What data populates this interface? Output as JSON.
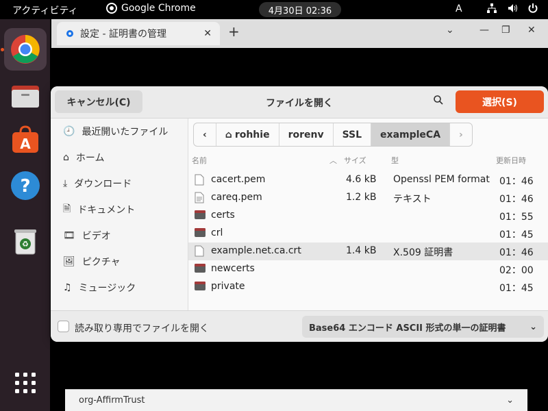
{
  "topbar": {
    "activities": "アクティビティ",
    "app_name": "Google Chrome",
    "clock": "4月30日  02:36",
    "input_method": "A"
  },
  "dock": {
    "apps": [
      {
        "name": "chrome-icon"
      },
      {
        "name": "files-icon"
      },
      {
        "name": "app-center-icon"
      },
      {
        "name": "help-icon"
      },
      {
        "name": "trash-icon"
      },
      {
        "name": "app-grid-icon"
      }
    ]
  },
  "browser": {
    "tab_title": "設定 - 証明書の管理",
    "new_tab": "+",
    "bottom_item": "org-AffirmTrust"
  },
  "dialog": {
    "title": "ファイルを開く",
    "cancel_label": "キャンセル(C)",
    "select_label": "選択(S)",
    "sidebar": [
      {
        "label": "最近開いたファイル",
        "icon": "recent-icon"
      },
      {
        "label": "ホーム",
        "icon": "home-icon"
      },
      {
        "label": "ダウンロード",
        "icon": "download-icon"
      },
      {
        "label": "ドキュメント",
        "icon": "document-icon"
      },
      {
        "label": "ビデオ",
        "icon": "video-icon"
      },
      {
        "label": "ピクチャ",
        "icon": "picture-icon"
      },
      {
        "label": "ミュージック",
        "icon": "music-icon"
      }
    ],
    "path": [
      "rohhie",
      "rorenv",
      "SSL",
      "exampleCA"
    ],
    "columns": {
      "name": "名前",
      "size": "サイズ",
      "type": "型",
      "modified": "更新日時"
    },
    "files": [
      {
        "name": "cacert.pem",
        "size": "4.6 kB",
        "type": "Openssl PEM format",
        "modified": "01：46",
        "kind": "file"
      },
      {
        "name": "careq.pem",
        "size": "1.2 kB",
        "type": "テキスト",
        "modified": "01：46",
        "kind": "text"
      },
      {
        "name": "certs",
        "size": "",
        "type": "",
        "modified": "01：55",
        "kind": "folder"
      },
      {
        "name": "crl",
        "size": "",
        "type": "",
        "modified": "01：45",
        "kind": "folder"
      },
      {
        "name": "example.net.ca.crt",
        "size": "1.4 kB",
        "type": "X.509 証明書",
        "modified": "01：46",
        "kind": "file"
      },
      {
        "name": "newcerts",
        "size": "",
        "type": "",
        "modified": "02：00",
        "kind": "folder"
      },
      {
        "name": "private",
        "size": "",
        "type": "",
        "modified": "01：45",
        "kind": "folder"
      }
    ],
    "readonly_label": "読み取り専用でファイルを開く",
    "filter_label": "Base64 エンコード ASCII 形式の単一の証明書"
  },
  "colors": {
    "accent": "#e95420",
    "dock": "#2a1f26"
  }
}
